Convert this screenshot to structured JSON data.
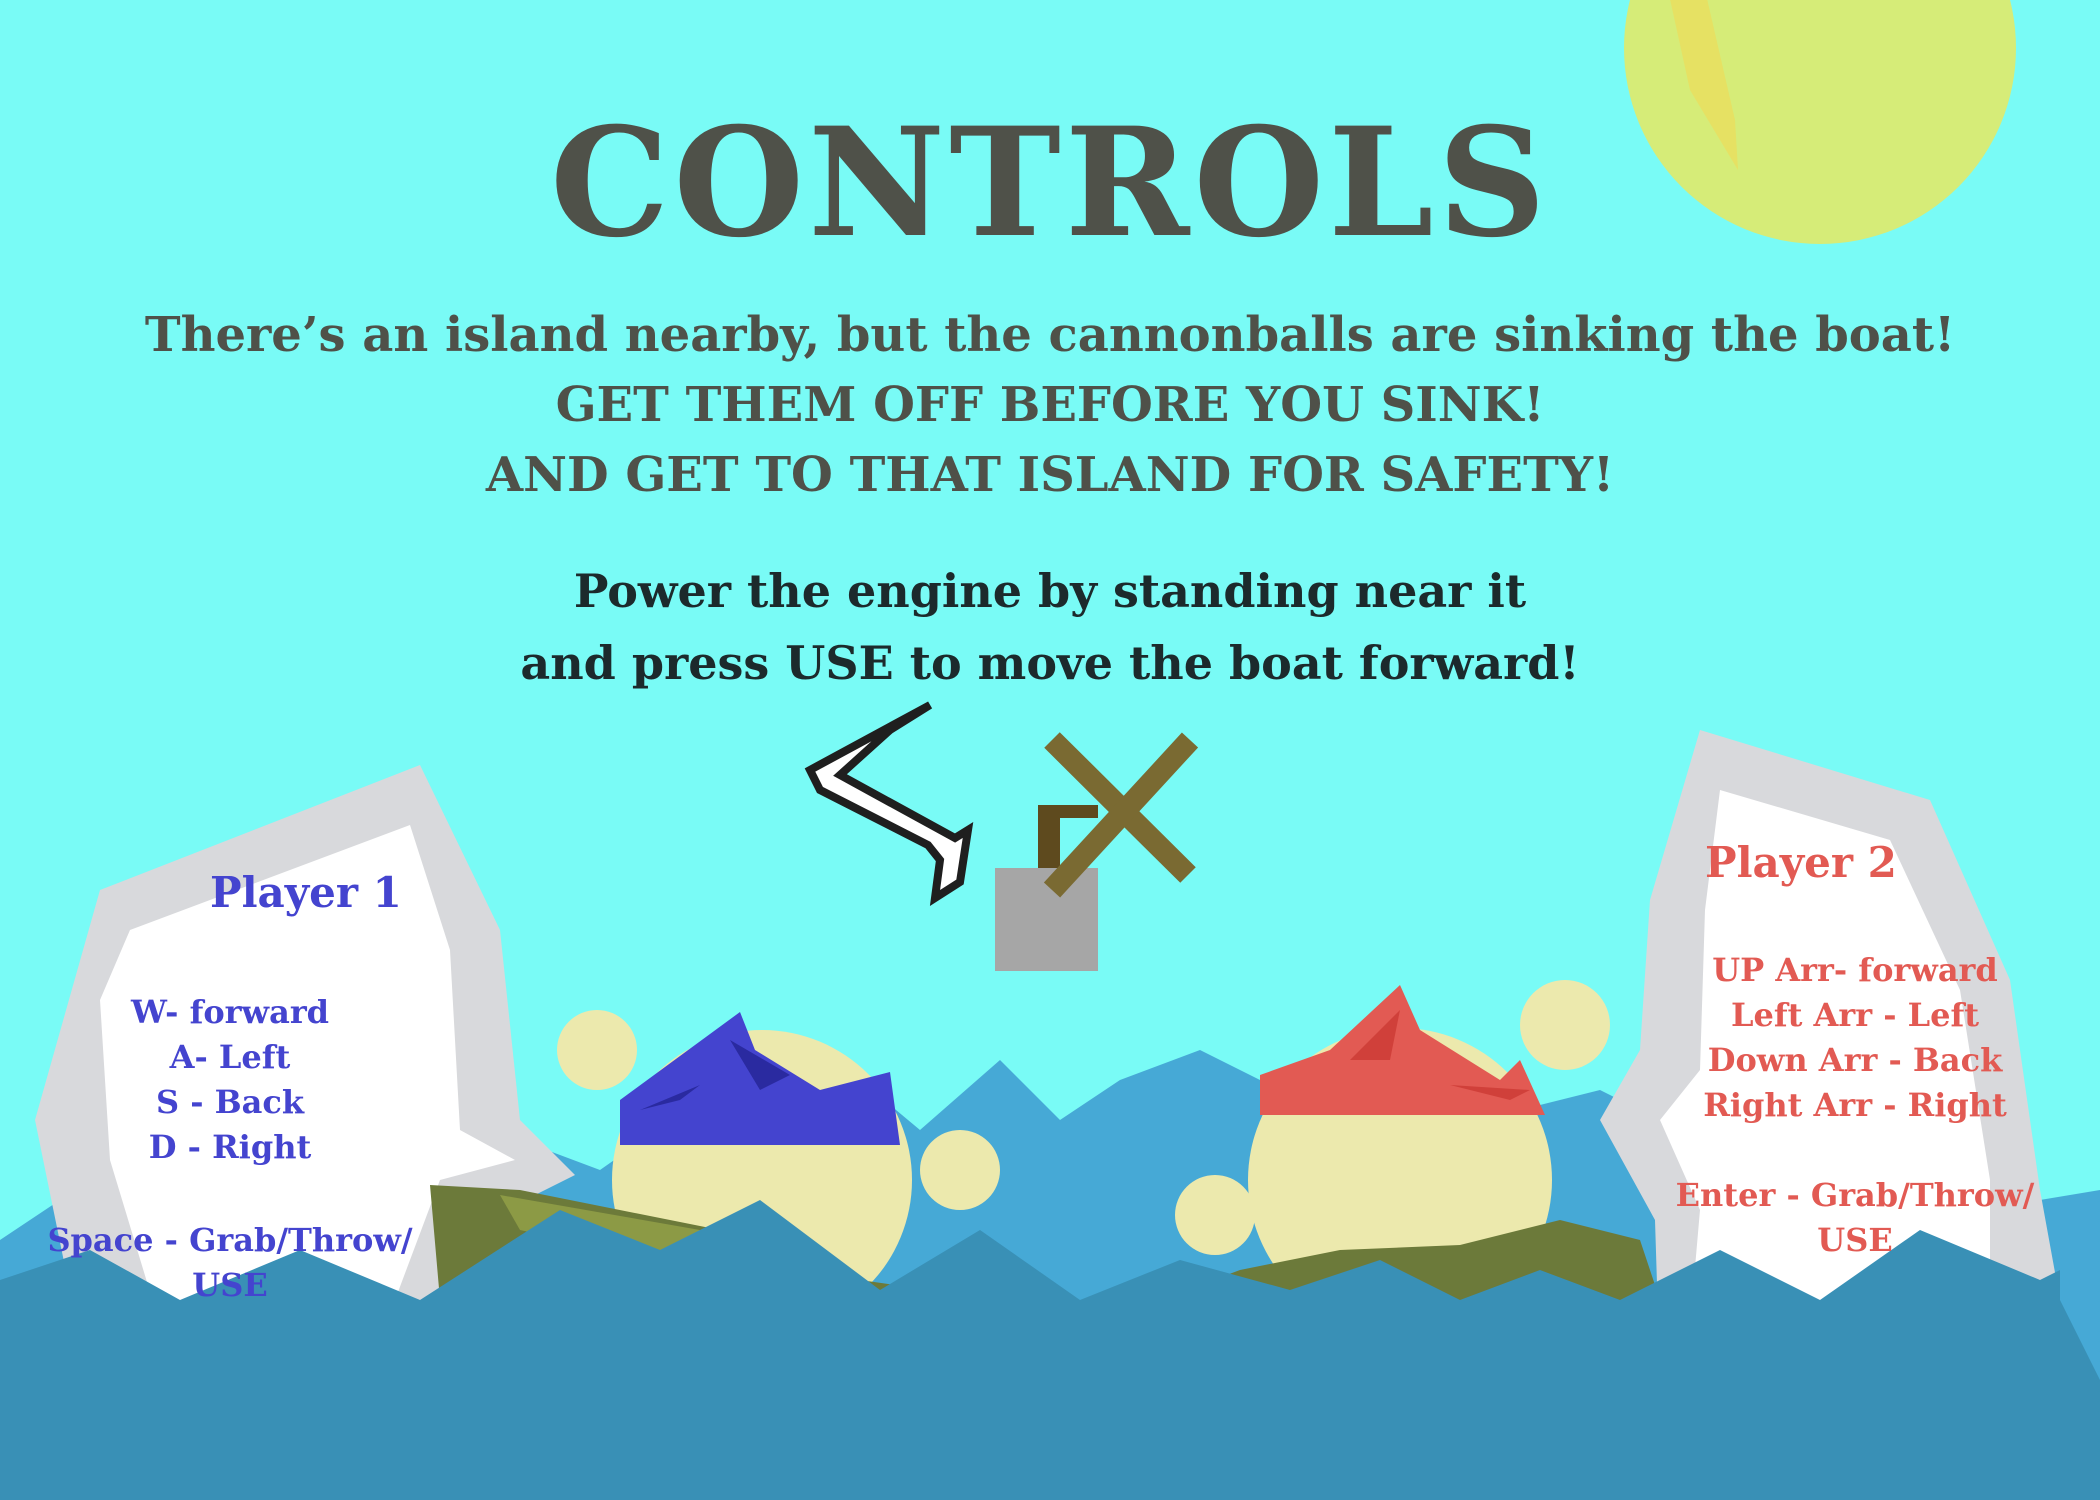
{
  "title": "CONTROLS",
  "intro": {
    "line1": "There’s an island nearby, but the cannonballs are sinking the boat!",
    "line2": "GET THEM OFF BEFORE YOU SINK!",
    "line3": "AND GET TO THAT ISLAND FOR SAFETY!"
  },
  "engine_hint": {
    "line1": "Power the engine by standing near it",
    "line2": "and press USE to move the boat forward!"
  },
  "player1": {
    "title": "Player 1",
    "color": "#4444cf",
    "controls": [
      "W- forward",
      "A- Left",
      "S - Back",
      "D - Right"
    ],
    "action_line1": "Space - Grab/Throw/",
    "action_line2": "USE"
  },
  "player2": {
    "title": "Player 2",
    "color": "#e25a53",
    "controls": [
      "UP Arr- forward",
      "Left Arr - Left",
      "Down Arr - Back",
      "Right Arr - Right"
    ],
    "action_line1": "Enter - Grab/Throw/",
    "action_line2": "USE"
  },
  "colors": {
    "sky": "#79fbf6",
    "sun": "#d6ec78",
    "water_dark": "#3990b6",
    "water_light": "#46a9d6",
    "boat": "#6c7a3a",
    "title_text": "#4f5149"
  },
  "icons": {
    "sun": "sun-icon",
    "arrow": "pointer-arrow-icon",
    "engine": "engine-windmill-icon"
  }
}
